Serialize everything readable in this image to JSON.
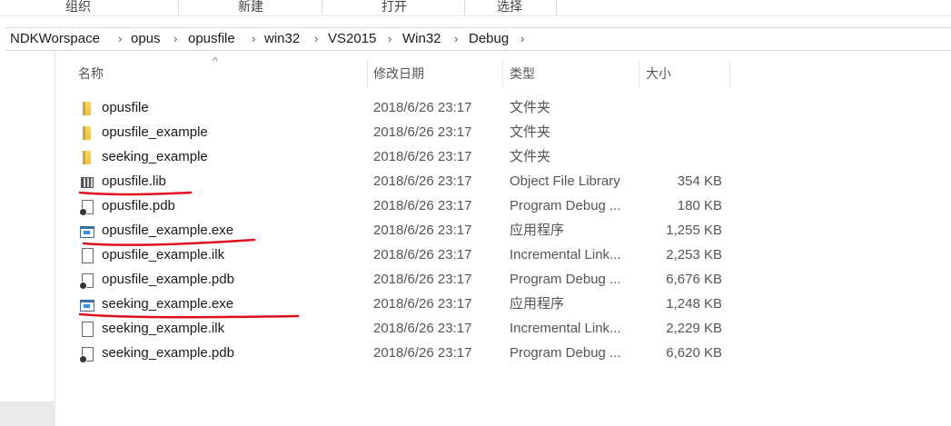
{
  "ribbon": {
    "groups": [
      "组织",
      "新建",
      "打开",
      "选择"
    ]
  },
  "address": {
    "crumbs": [
      "NDKWorspace",
      "opus",
      "opusfile",
      "win32",
      "VS2015",
      "Win32",
      "Debug"
    ]
  },
  "columns": {
    "name": "名称",
    "date": "修改日期",
    "type": "类型",
    "size": "大小"
  },
  "files": [
    {
      "name": "opusfile",
      "date": "2018/6/26 23:17",
      "type": "文件夹",
      "size": "",
      "icon": "folder-icon"
    },
    {
      "name": "opusfile_example",
      "date": "2018/6/26 23:17",
      "type": "文件夹",
      "size": "",
      "icon": "folder-icon"
    },
    {
      "name": "seeking_example",
      "date": "2018/6/26 23:17",
      "type": "文件夹",
      "size": "",
      "icon": "folder-icon"
    },
    {
      "name": "opusfile.lib",
      "date": "2018/6/26 23:17",
      "type": "Object File Library",
      "size": "354 KB",
      "icon": "library-file-icon"
    },
    {
      "name": "opusfile.pdb",
      "date": "2018/6/26 23:17",
      "type": "Program Debug ...",
      "size": "180 KB",
      "icon": "debug-file-icon"
    },
    {
      "name": "opusfile_example.exe",
      "date": "2018/6/26 23:17",
      "type": "应用程序",
      "size": "1,255 KB",
      "icon": "application-icon"
    },
    {
      "name": "opusfile_example.ilk",
      "date": "2018/6/26 23:17",
      "type": "Incremental Link...",
      "size": "2,253 KB",
      "icon": "file-icon"
    },
    {
      "name": "opusfile_example.pdb",
      "date": "2018/6/26 23:17",
      "type": "Program Debug ...",
      "size": "6,676 KB",
      "icon": "debug-file-icon"
    },
    {
      "name": "seeking_example.exe",
      "date": "2018/6/26 23:17",
      "type": "应用程序",
      "size": "1,248 KB",
      "icon": "application-icon"
    },
    {
      "name": "seeking_example.ilk",
      "date": "2018/6/26 23:17",
      "type": "Incremental Link...",
      "size": "2,229 KB",
      "icon": "file-icon"
    },
    {
      "name": "seeking_example.pdb",
      "date": "2018/6/26 23:17",
      "type": "Program Debug ...",
      "size": "6,620 KB",
      "icon": "debug-file-icon"
    }
  ],
  "annotations": {
    "underline_color": "#e0101a",
    "underlined_files": [
      "opusfile.lib",
      "opusfile_example.exe",
      "seeking_example.exe"
    ]
  }
}
